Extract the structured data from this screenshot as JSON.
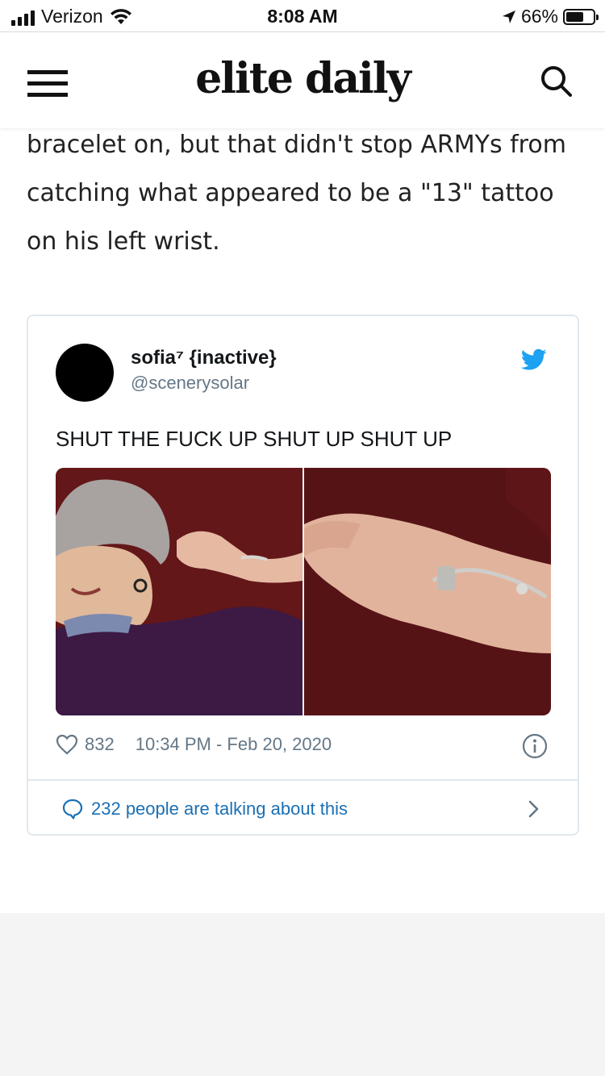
{
  "status_bar": {
    "carrier": "Verizon",
    "time": "8:08 AM",
    "battery_percent": "66%",
    "battery_level": 0.66,
    "signal_bars": 4,
    "icons": [
      "signal-icon",
      "wifi-icon",
      "location-arrow-icon",
      "battery-icon"
    ]
  },
  "header": {
    "logo": "elite daily",
    "menu_icon": "hamburger-menu-icon",
    "search_icon": "search-icon"
  },
  "article": {
    "lines": [
      "bracelet on, but that didn't stop ARMYs from",
      "catching what appeared to be a \"13\" tattoo",
      "on his left wrist."
    ]
  },
  "tweet": {
    "name": "sofia⁷ {inactive}",
    "handle": "@scenerysolar",
    "text": "SHUT THE FUCK UP SHUT UP SHUT UP",
    "likes": "832",
    "timestamp": "10:34 PM - Feb 20, 2020",
    "talking": "232 people are talking about this",
    "colors": {
      "twitter_blue": "#1da1f2",
      "link_blue": "#1b6fb3",
      "muted": "#657786",
      "border": "#e1e8ed"
    },
    "icons": [
      "twitter-bird-icon",
      "heart-icon",
      "info-icon",
      "speech-bubble-icon",
      "chevron-right-icon"
    ]
  }
}
